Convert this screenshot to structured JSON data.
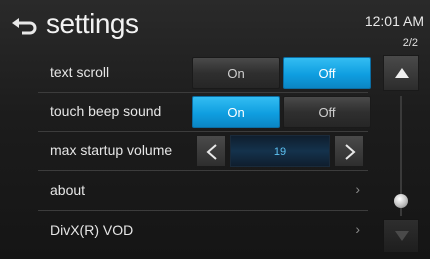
{
  "header": {
    "title": "settings",
    "clock": "12:01 AM",
    "page_indicator": "2/2"
  },
  "rows": [
    {
      "label": "text scroll",
      "on_label": "On",
      "off_label": "Off",
      "selected": "off"
    },
    {
      "label": "touch beep sound",
      "on_label": "On",
      "off_label": "Off",
      "selected": "on"
    },
    {
      "label": "max startup volume",
      "value": "19"
    },
    {
      "label": "about",
      "chevron": "›"
    },
    {
      "label": "DivX(R) VOD",
      "chevron": "›"
    }
  ],
  "scroll": {
    "position": 0.82
  },
  "colors": {
    "accent": "#0f9ee0",
    "background": "#1c1c1c",
    "value_text": "#5ec2f2"
  },
  "icons": {
    "back": "back-arrow-icon",
    "prev": "chevron-left-icon",
    "next": "chevron-right-icon",
    "up": "triangle-up-icon",
    "down": "triangle-down-icon"
  }
}
